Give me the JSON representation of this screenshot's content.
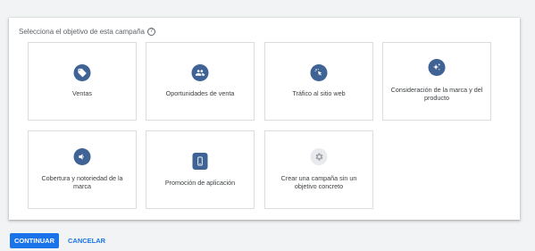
{
  "prompt": {
    "text": "Selecciona el objetivo de esta campaña",
    "help_icon": "help-circle-icon"
  },
  "goals": [
    {
      "label": "Ventas",
      "icon": "tag-icon",
      "icon_bg": "#3f6394"
    },
    {
      "label": "Oportunidades de venta",
      "icon": "people-icon",
      "icon_bg": "#3f6394"
    },
    {
      "label": "Tráfico al sitio web",
      "icon": "cursor-click-icon",
      "icon_bg": "#3f6394"
    },
    {
      "label": "Consideración de la marca y del producto",
      "icon": "sparkle-icon",
      "icon_bg": "#3f6394"
    },
    {
      "label": "Cobertura y notoriedad de la marca",
      "icon": "megaphone-icon",
      "icon_bg": "#3f6394"
    },
    {
      "label": "Promoción de aplicación",
      "icon": "smartphone-icon",
      "icon_bg": "#3f6394"
    },
    {
      "label": "Crear una campaña sin un objetivo concreto",
      "icon": "gear-icon",
      "icon_bg": "#e8eaed"
    }
  ],
  "actions": {
    "continue_label": "CONTINUAR",
    "cancel_label": "CANCELAR"
  },
  "colors": {
    "accent": "#1a73e8",
    "icon_primary": "#3f6394",
    "icon_muted": "#e8eaed"
  }
}
